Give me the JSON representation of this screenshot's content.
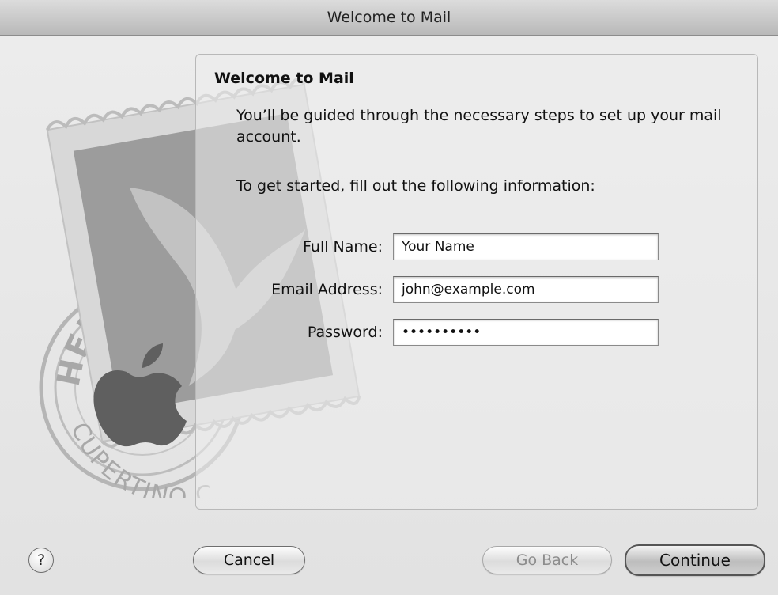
{
  "window": {
    "title": "Welcome to Mail"
  },
  "panel": {
    "heading": "Welcome to Mail",
    "intro": "You’ll be guided through the necessary steps to set up your mail account.",
    "prompt": "To get started, fill out the following information:"
  },
  "form": {
    "full_name": {
      "label": "Full Name:",
      "value": "Your Name"
    },
    "email": {
      "label": "Email Address:",
      "value": "john@example.com"
    },
    "password": {
      "label": "Password:",
      "value": "••••••••••"
    }
  },
  "stamp": {
    "top_text": "HELLO FROM",
    "bottom_text": "CUPERTINO CA"
  },
  "buttons": {
    "help": "?",
    "cancel": "Cancel",
    "go_back": "Go Back",
    "continue": "Continue"
  }
}
